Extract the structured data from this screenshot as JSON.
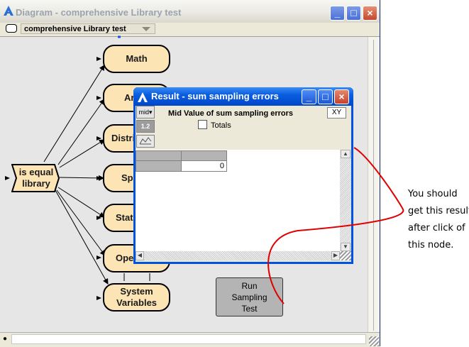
{
  "window": {
    "title": "Diagram - comprehensive Library test",
    "controls": {
      "minimize": "_",
      "maximize": "□",
      "close": "×"
    }
  },
  "toolbar": {
    "library_selector": "comprehensive Library test"
  },
  "nodes": {
    "library": "is equal library",
    "math": "Math",
    "array": "Ar",
    "distribution": "Distri",
    "special": "Spe",
    "statistical": "Stati",
    "operations": "Ope",
    "system_variables": "System Variables",
    "run_button": "Run Sampling Test"
  },
  "result_window": {
    "title": "Result - sum sampling errors",
    "mode_select": "mid▾",
    "heading": "Mid Value of sum sampling errors",
    "totals_label": "Totals",
    "xy_button": "XY",
    "table_value": "0"
  },
  "annotation": {
    "text": "You should\nget this result\nafter click of\nthis node."
  },
  "colors": {
    "node_fill": "#fde4b4",
    "canvas": "#e6e6e6",
    "arrow": "#e00000",
    "result_titlebar": "#0054e3"
  }
}
